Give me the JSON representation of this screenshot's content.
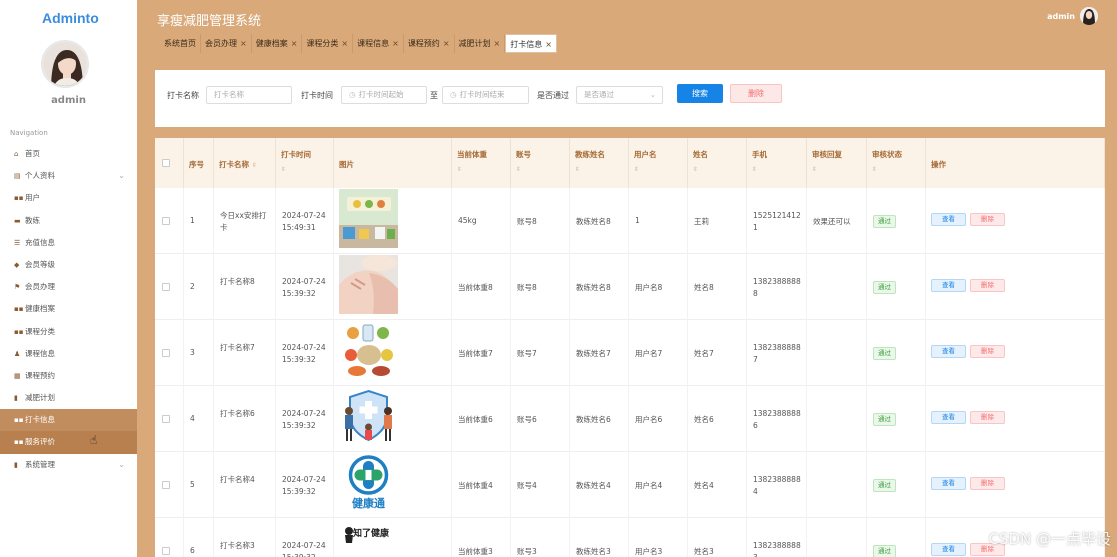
{
  "app": {
    "logo": "Adminto",
    "title": "享瘦减肥管理系统",
    "user": "admin"
  },
  "sidebar": {
    "username": "admin",
    "nav_heading": "Navigation",
    "items": [
      {
        "label": "首页",
        "icon": "home-icon"
      },
      {
        "label": "个人资料",
        "icon": "profile-icon",
        "expandable": true
      },
      {
        "label": "用户",
        "icon": "grid-icon"
      },
      {
        "label": "教练",
        "icon": "coach-icon"
      },
      {
        "label": "充值信息",
        "icon": "list-icon"
      },
      {
        "label": "会员等级",
        "icon": "vip-icon"
      },
      {
        "label": "会员办理",
        "icon": "flag-icon"
      },
      {
        "label": "健康档案",
        "icon": "grid-icon"
      },
      {
        "label": "课程分类",
        "icon": "grid-icon"
      },
      {
        "label": "课程信息",
        "icon": "person-icon"
      },
      {
        "label": "课程预约",
        "icon": "calendar-icon"
      },
      {
        "label": "减肥计划",
        "icon": "chart-icon"
      },
      {
        "label": "打卡信息",
        "icon": "grid-icon",
        "active": true
      },
      {
        "label": "服务评价",
        "icon": "grid-icon",
        "hover": true
      },
      {
        "label": "系统管理",
        "icon": "chart-icon",
        "expandable": true
      }
    ]
  },
  "tabs": [
    {
      "label": "系统首页",
      "closable": false
    },
    {
      "label": "会员办理",
      "closable": true
    },
    {
      "label": "健康档案",
      "closable": true
    },
    {
      "label": "课程分类",
      "closable": true
    },
    {
      "label": "课程信息",
      "closable": true
    },
    {
      "label": "课程预约",
      "closable": true
    },
    {
      "label": "减肥计划",
      "closable": true
    },
    {
      "label": "打卡信息",
      "closable": true,
      "active": true
    }
  ],
  "search": {
    "name_label": "打卡名称",
    "name_placeholder": "打卡名称",
    "time_label": "打卡时间",
    "start_placeholder": "打卡时间起始",
    "range_sep": "至",
    "end_placeholder": "打卡时间结束",
    "pass_label": "是否通过",
    "pass_placeholder": "是否通过",
    "search_button": "搜索",
    "delete_button": "删除"
  },
  "table": {
    "columns": [
      "序号",
      "打卡名称",
      "打卡时间",
      "图片",
      "当前体重",
      "账号",
      "教练姓名",
      "用户名",
      "姓名",
      "手机",
      "审核回复",
      "审核状态",
      "操作"
    ],
    "view_label": "查看",
    "delete_label": "删除",
    "rows": [
      {
        "index": "1",
        "name": "今日xx安排打卡",
        "date": "2024-07-24",
        "time": "15:49:31",
        "image": "activity-illustration",
        "weight": "45kg",
        "account": "账号8",
        "coach": "教练姓名8",
        "username": "1",
        "realname": "王莉",
        "phone": "15251214121",
        "reply": "效果还可以",
        "status": "通过"
      },
      {
        "index": "2",
        "name": "打卡名称8",
        "date": "2024-07-24",
        "time": "15:39:32",
        "image": "shoulder-photo",
        "weight": "当前体重8",
        "account": "账号8",
        "coach": "教练姓名8",
        "username": "用户名8",
        "realname": "姓名8",
        "phone": "13823888888",
        "reply": "",
        "status": "通过"
      },
      {
        "index": "3",
        "name": "打卡名称7",
        "date": "2024-07-24",
        "time": "15:39:32",
        "image": "healthy-food-illustration",
        "weight": "当前体重7",
        "account": "账号7",
        "coach": "教练姓名7",
        "username": "用户名7",
        "realname": "姓名7",
        "phone": "13823888887",
        "reply": "",
        "status": "通过"
      },
      {
        "index": "4",
        "name": "打卡名称6",
        "date": "2024-07-24",
        "time": "15:39:32",
        "image": "family-shield-illustration",
        "weight": "当前体重6",
        "account": "账号6",
        "coach": "教练姓名6",
        "username": "用户名6",
        "realname": "姓名6",
        "phone": "13823888886",
        "reply": "",
        "status": "通过"
      },
      {
        "index": "5",
        "name": "打卡名称4",
        "date": "2024-07-24",
        "time": "15:39:32",
        "image": "jiankangtong-logo",
        "image_text": "健康通",
        "weight": "当前体重4",
        "account": "账号4",
        "coach": "教练姓名4",
        "username": "用户名4",
        "realname": "姓名4",
        "phone": "13823888884",
        "reply": "",
        "status": "通过"
      },
      {
        "index": "6",
        "name": "打卡名称3",
        "date": "2024-07-24",
        "time": "15:39:32",
        "image": "zhiliao-jiankang-logo",
        "image_text": "知了健康",
        "weight": "当前体重3",
        "account": "账号3",
        "coach": "教练姓名3",
        "username": "用户名3",
        "realname": "姓名3",
        "phone": "13823888883",
        "reply": "",
        "status": "通过"
      }
    ]
  },
  "watermark": "CSDN @一点毕设",
  "colors": {
    "accent": "#d9a97a",
    "sidebar_active": "#c28d5e",
    "primary": "#1683e6",
    "danger": "#f56c6c",
    "success": "#3aa13a"
  }
}
